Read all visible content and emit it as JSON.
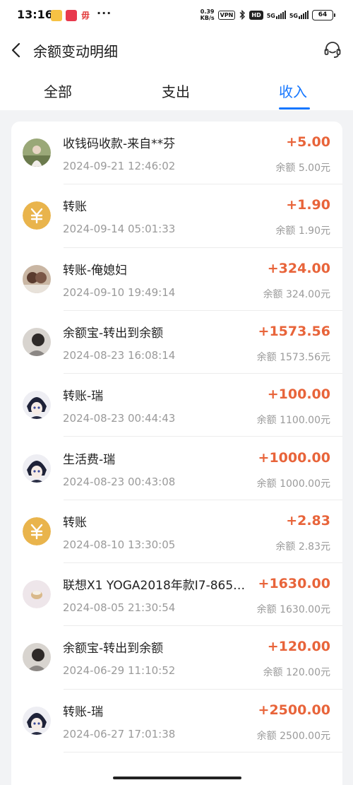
{
  "status_bar": {
    "time": "13:16",
    "dots": "···",
    "app3": "毋",
    "speed_value": "0.39",
    "speed_unit": "KB/s",
    "vpn": "VPN",
    "hd": "HD",
    "net1": "5G",
    "net2": "5G",
    "battery": "64"
  },
  "header": {
    "title": "余额变动明细"
  },
  "tabs": [
    {
      "label": "全部"
    },
    {
      "label": "支出"
    },
    {
      "label": "收入"
    }
  ],
  "active_tab": "收入",
  "balance_prefix": "余额",
  "transactions": [
    {
      "title": "收钱码收款-来自**芬",
      "time": "2024-09-21 12:46:02",
      "amount": "+5.00",
      "balance": "余额 5.00元",
      "avatar": "photo-avatar"
    },
    {
      "title": "转账",
      "time": "2024-09-14 05:01:33",
      "amount": "+1.90",
      "balance": "余额 1.90元",
      "avatar": "yuan-icon"
    },
    {
      "title": "转账-俺媳妇",
      "time": "2024-09-10 19:49:14",
      "amount": "+324.00",
      "balance": "余额 324.00元",
      "avatar": "photo-avatar"
    },
    {
      "title": "余额宝-转出到余额",
      "time": "2024-08-23 16:08:14",
      "amount": "+1573.56",
      "balance": "余额 1573.56元",
      "avatar": "photo-avatar"
    },
    {
      "title": "转账-瑞",
      "time": "2024-08-23 00:44:43",
      "amount": "+100.00",
      "balance": "余额 1100.00元",
      "avatar": "anime-avatar"
    },
    {
      "title": "生活费-瑞",
      "time": "2024-08-23 00:43:08",
      "amount": "+1000.00",
      "balance": "余额 1000.00元",
      "avatar": "anime-avatar"
    },
    {
      "title": "转账",
      "time": "2024-08-10 13:30:05",
      "amount": "+2.83",
      "balance": "余额 2.83元",
      "avatar": "yuan-icon"
    },
    {
      "title": "联想X1 YOGA2018年款I7-865…",
      "time": "2024-08-05 21:30:54",
      "amount": "+1630.00",
      "balance": "余额 1630.00元",
      "avatar": "product-avatar"
    },
    {
      "title": "余额宝-转出到余额",
      "time": "2024-06-29 11:10:52",
      "amount": "+120.00",
      "balance": "余额 120.00元",
      "avatar": "photo-avatar"
    },
    {
      "title": "转账-瑞",
      "time": "2024-06-27 17:01:38",
      "amount": "+2500.00",
      "balance": "余额 2500.00元",
      "avatar": "anime-avatar"
    }
  ],
  "colors": {
    "accent": "#1677ff",
    "amount": "#e8643a",
    "yuan_icon_bg": "#e9b44c"
  }
}
